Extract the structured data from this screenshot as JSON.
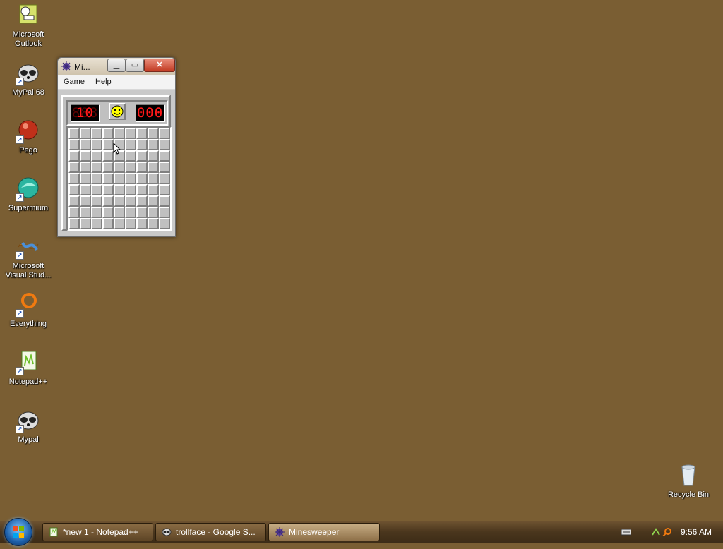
{
  "desktop": {
    "icons": [
      {
        "label": "Microsoft Outlook",
        "icon": "outlook-icon"
      },
      {
        "label": "MyPal 68",
        "icon": "raccoon-icon"
      },
      {
        "label": "Pego",
        "icon": "pego-icon"
      },
      {
        "label": "Supermium",
        "icon": "supermium-icon"
      },
      {
        "label": "Microsoft Visual Stud...",
        "icon": "visual-studio-icon"
      },
      {
        "label": "Everything",
        "icon": "everything-icon"
      },
      {
        "label": "Notepad++",
        "icon": "notepadpp-icon"
      },
      {
        "label": "Mypal",
        "icon": "raccoon-icon"
      },
      {
        "label": "Recycle Bin",
        "icon": "recycle-bin-icon"
      }
    ]
  },
  "minesweeper": {
    "title": "Mi...",
    "menu": {
      "game": "Game",
      "help": "Help"
    },
    "mines_counter": "10",
    "timer": "000",
    "lcd_ghost": "888",
    "grid_rows": 9,
    "grid_cols": 9,
    "smiley": "smiley-face-icon"
  },
  "taskbar": {
    "items": [
      {
        "label": "*new 1 - Notepad++",
        "icon": "notepadpp-icon"
      },
      {
        "label": "trollface - Google S...",
        "icon": "raccoon-icon"
      },
      {
        "label": "Minesweeper",
        "icon": "minesweeper-icon"
      }
    ],
    "clock": "9:56 AM"
  },
  "colors": {
    "desktop": "#7a5e33",
    "lcd_text": "#ff1a1a",
    "window_face": "#c0c0c0"
  }
}
